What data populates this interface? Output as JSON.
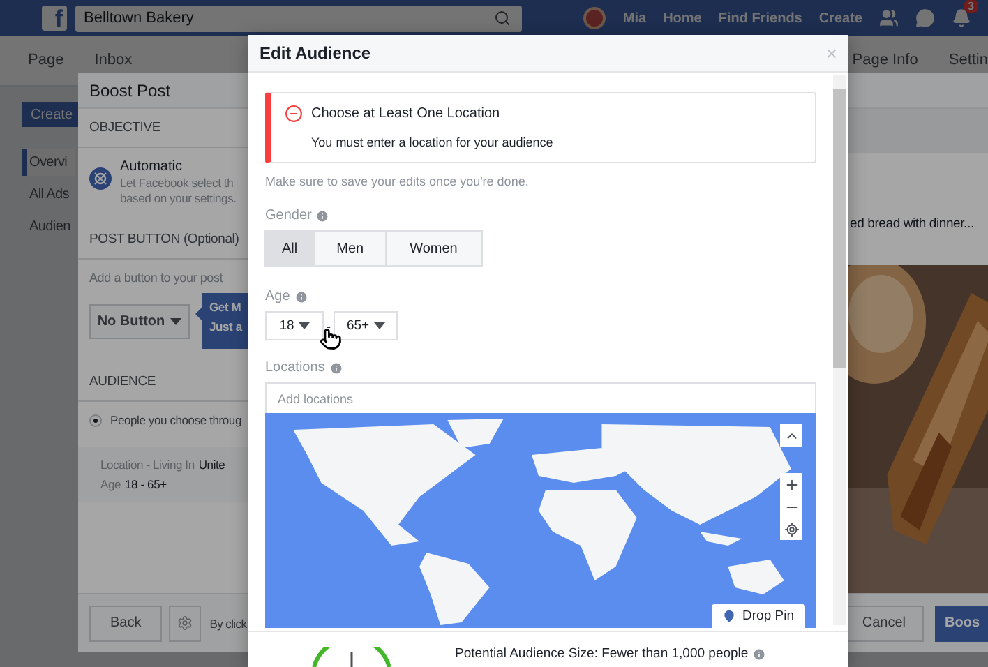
{
  "top_bar": {
    "logo": "f",
    "search": {
      "value": "Belltown Bakery"
    },
    "user_name": "Mia",
    "links": [
      "Home",
      "Find Friends",
      "Create"
    ],
    "notification_count": "3"
  },
  "page_tabs": [
    "Page",
    "Inbox"
  ],
  "page_tabs_end": [
    "Page Info",
    "Settin"
  ],
  "sidebar": {
    "button": "Create",
    "items": [
      {
        "label": "Overvi",
        "selected": true
      },
      {
        "label": "All Ads",
        "selected": false
      },
      {
        "label": "Audien",
        "selected": false
      }
    ]
  },
  "boost_post": {
    "title": "Boost Post",
    "objective": {
      "heading": "OBJECTIVE",
      "option": "Automatic",
      "description": "Let Facebook select th based on your settings."
    },
    "post_button": {
      "heading": "POST BUTTON (Optional)",
      "hint": "Add a button to your post",
      "select": "No Button",
      "tip": [
        "Get M",
        "Just a"
      ]
    },
    "audience": {
      "heading": "AUDIENCE",
      "options": [
        {
          "label": "People you choose throug",
          "selected": true
        }
      ],
      "location_label": "Location - Living In",
      "location_value": "Unite",
      "age_label": "Age",
      "age_value": "18 - 65+"
    },
    "preview_text": "ed bread with dinner...",
    "footer": {
      "back": "Back",
      "terms": "By click",
      "cancel": "Cancel",
      "boost": "Boos"
    }
  },
  "edit_audience": {
    "title": "Edit Audience",
    "close": "×",
    "alert": {
      "title": "Choose at Least One Location",
      "message": "You must enter a location for your audience"
    },
    "note": "Make sure to save your edits once you're done.",
    "gender": {
      "label": "Gender",
      "options": [
        {
          "label": "All",
          "selected": true
        },
        {
          "label": "Men",
          "selected": false
        },
        {
          "label": "Women",
          "selected": false
        }
      ]
    },
    "age": {
      "label": "Age",
      "from": "18",
      "separator": "-",
      "to": "65+"
    },
    "locations": {
      "label": "Locations",
      "placeholder": "Add locations",
      "drop_pin": "Drop Pin"
    },
    "audience_size": "Potential Audience Size: Fewer than 1,000 people"
  }
}
